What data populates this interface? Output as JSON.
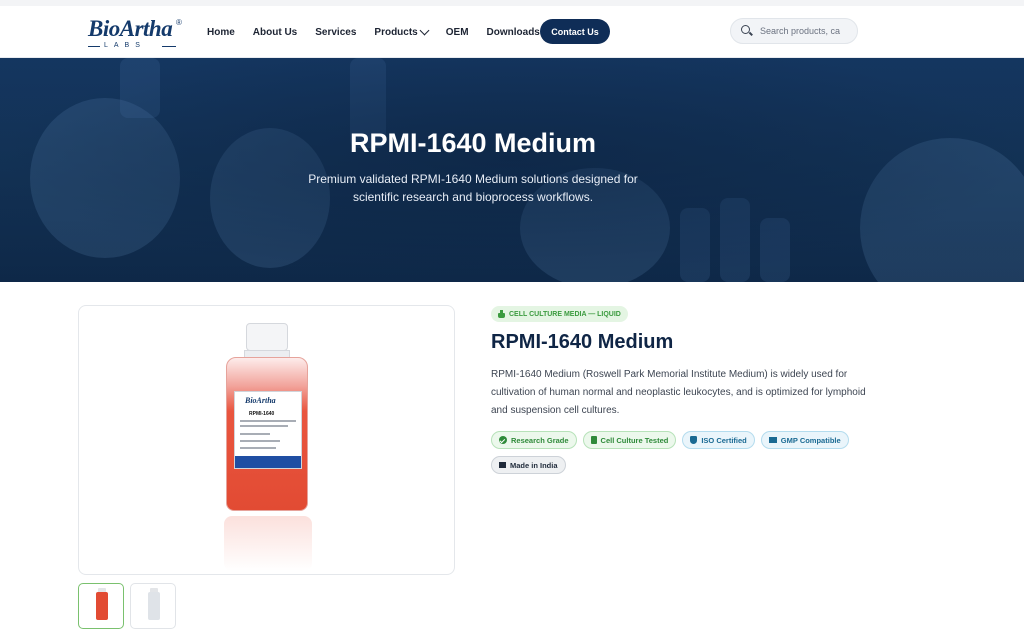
{
  "header": {
    "logo_text": "BioArtha",
    "logo_reg": "®",
    "logo_sub": "LABS",
    "nav": [
      {
        "label": "Home"
      },
      {
        "label": "About Us"
      },
      {
        "label": "Services"
      },
      {
        "label": "Products",
        "icon": "chevron-down-icon"
      },
      {
        "label": "OEM"
      },
      {
        "label": "Downloads"
      }
    ],
    "contact_label": "Contact Us",
    "search_placeholder": "Search products, ca"
  },
  "hero": {
    "title": "RPMI-1640 Medium",
    "subtitle": "Premium validated RPMI-1640 Medium solutions designed for scientific research and bioprocess workflows."
  },
  "product": {
    "category": "CELL CULTURE MEDIA — LIQUID",
    "title": "RPMI-1640 Medium",
    "description": "RPMI-1640 Medium (Roswell Park Memorial Institute Medium) is widely used for cultivation of human normal and neoplastic leukocytes, and is optimized for lymphoid and suspension cell cultures.",
    "image_label_logo": "BioArtha",
    "image_label_name": "RPMI-1640",
    "badges": [
      {
        "label": "Research Grade",
        "icon": "check-circle-icon",
        "color": "#2f8a3a"
      },
      {
        "label": "Cell Culture Tested",
        "icon": "flask-icon",
        "color": "#2f8a3a"
      },
      {
        "label": "ISO Certified",
        "icon": "shield-icon",
        "color": "#1b6a93"
      },
      {
        "label": "GMP Compatible",
        "icon": "factory-icon",
        "color": "#1b6a93"
      },
      {
        "label": "Made in India",
        "icon": "flag-icon",
        "color": "#1f2a3a"
      }
    ]
  },
  "colors": {
    "primary": "#0f2d57",
    "accent_green": "#3b9b3f",
    "hero_bg": "#143559"
  }
}
